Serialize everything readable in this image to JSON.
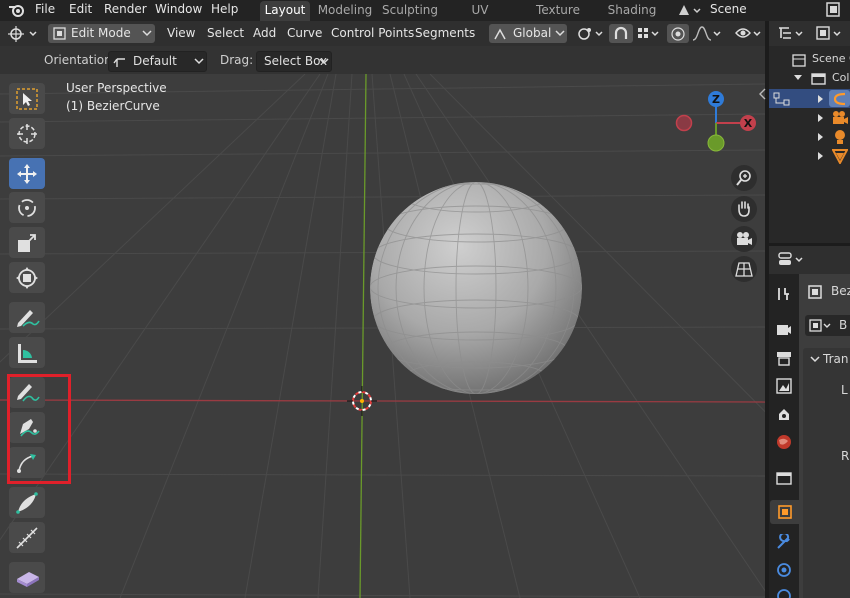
{
  "topbar": {
    "menus": [
      "File",
      "Edit",
      "Render",
      "Window",
      "Help"
    ],
    "workspaces": [
      "Layout",
      "Modeling",
      "Sculpting",
      "UV Editing",
      "Texture Paint",
      "Shading"
    ],
    "scene_label": "Scene"
  },
  "header": {
    "mode": "Edit Mode",
    "menus": [
      "View",
      "Select",
      "Add",
      "Curve",
      "Control Points",
      "Segments"
    ],
    "transform_orientation": "Global"
  },
  "tool_settings": {
    "orientation_label": "Orientation:",
    "orientation_value": "Default",
    "drag_label": "Drag:",
    "drag_value": "Select Box"
  },
  "viewport": {
    "perspective_label": "User Perspective",
    "object_label": "(1) BezierCurve",
    "gizmo": {
      "z": "Z",
      "x": "X"
    }
  },
  "toolbar": {
    "tools": [
      "select-box",
      "cursor",
      "move",
      "rotate",
      "scale",
      "transform",
      "annotate",
      "measure",
      "draw",
      "pen",
      "curve-extrude",
      "radius",
      "tilt",
      "randomize"
    ],
    "active_tool": "move",
    "highlight_color": "#e0202a"
  },
  "outliner": {
    "scene_collection": "Scene C",
    "collection": "Col"
  },
  "properties": {
    "object_name": "Bez",
    "data_label": "B",
    "section": "Tran",
    "field_l": "L",
    "field_r": "R"
  },
  "colors": {
    "active_tool": "#4772b3",
    "x_axis": "#c2404c",
    "y_axis": "#6a9a2a",
    "z_axis": "#2f7bd8",
    "highlight_box": "#e0202a"
  }
}
